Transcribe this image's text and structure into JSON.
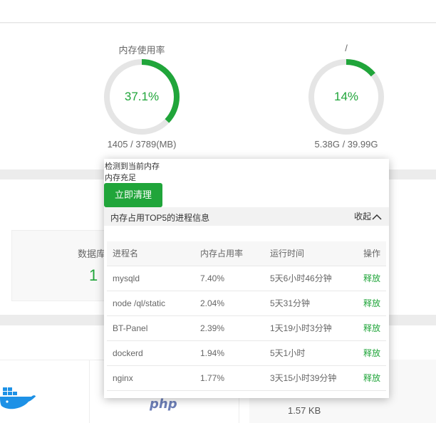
{
  "gauges": [
    {
      "title": "内存使用率",
      "value": "37.1%",
      "percent": 37.1,
      "detail": "1405 / 3789(MB)"
    },
    {
      "title": "/",
      "value": "14%",
      "percent": 14,
      "detail": "5.38G / 39.99G"
    }
  ],
  "database_card": {
    "title": "数据库",
    "count": "1"
  },
  "software": {
    "php_label": "php",
    "size": "1.57 KB"
  },
  "popup": {
    "line1": "检测到当前内存",
    "line2": "内存充足",
    "clean_button": "立即清理",
    "process_header": "内存占用TOP5的进程信息",
    "collapse_label": "收起",
    "table": {
      "columns": [
        "进程名",
        "内存占用率",
        "运行时间",
        "操作"
      ],
      "rows": [
        {
          "name": "mysqld",
          "mem": "7.40%",
          "time": "5天6小时46分钟",
          "action": "释放"
        },
        {
          "name": "node /ql/static",
          "mem": "2.04%",
          "time": "5天31分钟",
          "action": "释放"
        },
        {
          "name": "BT-Panel",
          "mem": "2.39%",
          "time": "1天19小时3分钟",
          "action": "释放"
        },
        {
          "name": "dockerd",
          "mem": "1.94%",
          "time": "5天1小时",
          "action": "释放"
        },
        {
          "name": "nginx",
          "mem": "1.77%",
          "time": "3天15小时39分钟",
          "action": "释放"
        }
      ]
    }
  },
  "colors": {
    "accent": "#20a53a",
    "track": "#e5e5e5"
  }
}
